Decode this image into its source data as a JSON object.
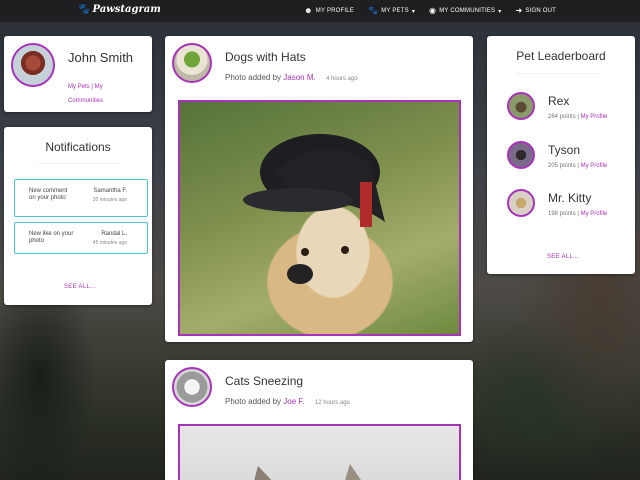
{
  "navbar": {
    "brand": "Pawstagram",
    "items": [
      {
        "label": "MY PROFILE",
        "icon": "user-circle-icon"
      },
      {
        "label": "MY PETS",
        "icon": "paw-icon"
      },
      {
        "label": "MY COMMUNITIES",
        "icon": "globe-icon"
      },
      {
        "label": "SIGN OUT",
        "icon": "sign-out-icon"
      }
    ]
  },
  "profile": {
    "name": "John Smith",
    "link_pets": "My Pets",
    "separator": "|",
    "link_communities": "My Communities"
  },
  "notifications": {
    "title": "Notifications",
    "items": [
      {
        "message": "New comment on your photo",
        "from": "Samantha F.",
        "time": "30 minutes ago"
      },
      {
        "message": "New like on your photo",
        "from": "Randal L.",
        "time": "45 minutes ago"
      }
    ],
    "see_all": "SEE ALL..."
  },
  "posts": [
    {
      "title": "Dogs with Hats",
      "prefix": "Photo added by",
      "author": "Jason M.",
      "time": "4 hours ago"
    },
    {
      "title": "Cats Sneezing",
      "prefix": "Photo added by",
      "author": "Joe F.",
      "time": "12 hours ago"
    }
  ],
  "leaderboard": {
    "title": "Pet Leaderboard",
    "items": [
      {
        "name": "Rex",
        "points": "264 points",
        "separator": "|",
        "link": "My Profile"
      },
      {
        "name": "Tyson",
        "points": "205 points",
        "separator": "|",
        "link": "My Profile"
      },
      {
        "name": "Mr. Kitty",
        "points": "198 points",
        "separator": "|",
        "link": "My Profile"
      }
    ],
    "see_all": "SEE ALL..."
  },
  "colors": {
    "accent": "#a633b8",
    "notification_border": "#4fc3d4",
    "navbar": "#1f1f22"
  }
}
